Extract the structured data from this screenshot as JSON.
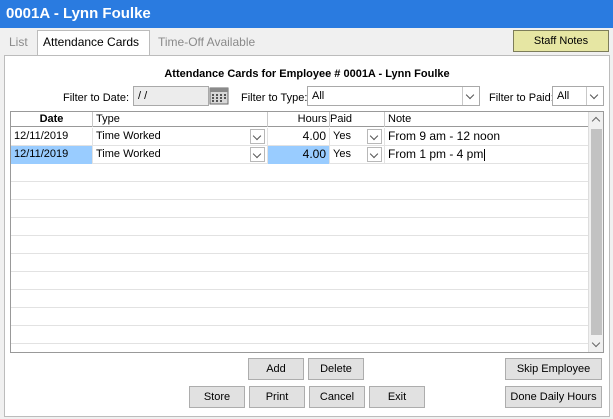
{
  "window": {
    "title": "0001A - Lynn Foulke"
  },
  "tabs": [
    {
      "label": "List"
    },
    {
      "label": "Attendance Cards"
    },
    {
      "label": "Time-Off Available"
    }
  ],
  "staff_notes_label": "Staff Notes",
  "heading": "Attendance Cards for Employee # 0001A - Lynn Foulke",
  "filters": {
    "date_label": "Filter to Date:",
    "date_value": " / /",
    "type_label": "Filter to Type:",
    "type_value": "All",
    "paid_label": "Filter to Paid:",
    "paid_value": "All"
  },
  "grid": {
    "columns": [
      "Date",
      "Type",
      "Hours",
      "Paid",
      "Note"
    ],
    "rows": [
      {
        "date": "12/11/2019",
        "type": "Time Worked",
        "hours": "4.00",
        "paid": "Yes",
        "note": "From 9 am - 12 noon"
      },
      {
        "date": "12/11/2019",
        "type": "Time Worked",
        "hours": "4.00",
        "paid": "Yes",
        "note": "From 1 pm - 4 pm"
      }
    ]
  },
  "buttons": {
    "add": "Add",
    "delete": "Delete",
    "skip_employee": "Skip Employee",
    "store": "Store",
    "print": "Print",
    "cancel": "Cancel",
    "exit": "Exit",
    "done_daily_hours": "Done Daily Hours"
  }
}
